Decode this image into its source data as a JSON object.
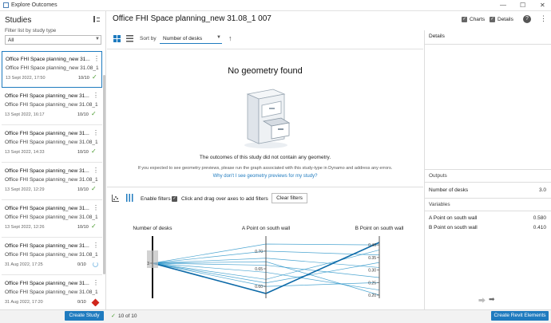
{
  "window": {
    "title": "Explore Outcomes",
    "minimize": "—",
    "maximize": "☐",
    "close": "✕"
  },
  "sidebar": {
    "heading": "Studies",
    "filter_label": "Filter list by study type",
    "filter_value": "All",
    "studies": [
      {
        "name": "Office FHI Space planning_new 31...",
        "subtitle": "Office FHI Space planning_new 31.08_1",
        "date": "13 Sept 2022, 17:50",
        "count": "10/10",
        "status": "complete"
      },
      {
        "name": "Office FHI Space planning_new 31...",
        "subtitle": "Office FHI Space planning_new 31.08_1",
        "date": "13 Sept 2022, 16:17",
        "count": "10/10",
        "status": "complete"
      },
      {
        "name": "Office FHI Space planning_new 31...",
        "subtitle": "Office FHI Space planning_new 31.08_1",
        "date": "13 Sept 2022, 14:33",
        "count": "10/10",
        "status": "complete"
      },
      {
        "name": "Office FHI Space planning_new 31...",
        "subtitle": "Office FHI Space planning_new 31.08_1",
        "date": "13 Sept 2022, 12:29",
        "count": "10/10",
        "status": "complete"
      },
      {
        "name": "Office FHI Space planning_new 31...",
        "subtitle": "Office FHI Space planning_new 31.08_1",
        "date": "13 Sept 2022, 12:26",
        "count": "10/10",
        "status": "complete"
      },
      {
        "name": "Office FHI Space planning_new 31...",
        "subtitle": "Office FHI Space planning_new 31.08_1",
        "date": "31 Aug 2022, 17:25",
        "count": "0/10",
        "status": "running"
      },
      {
        "name": "Office FHI Space planning_new 31...",
        "subtitle": "Office FHI Space planning_new 31.08_1",
        "date": "31 Aug 2022, 17:20",
        "count": "0/10",
        "status": "error"
      }
    ],
    "create_study": "Create Study"
  },
  "status_bar": {
    "text": "10 of 10",
    "create_revit": "Create Revit Elements"
  },
  "main": {
    "title": "Office FHI Space planning_new 31.08_1 007",
    "sort_label": "Sort by",
    "sort_value": "Number of desks",
    "no_geometry_title": "No geometry found",
    "no_geometry_msg": "The outcomes of this study did not contain any geometry.",
    "no_geometry_hint": "If you expected to see geometry previews, please run the graph associated with this study-type in Dynamo and address any errors.",
    "no_geometry_link": "Why don't I see geometry previews for my study?",
    "enable_filters": "Enable filters",
    "filter_hint": "Click and drag over axes to add filters",
    "clear_filters": "Clear filters"
  },
  "topbar": {
    "charts": "Charts",
    "details": "Details",
    "help": "?"
  },
  "details": {
    "heading": "Details",
    "outputs_heading": "Outputs",
    "outputs": [
      {
        "label": "Number of desks",
        "value": "3.0"
      }
    ],
    "variables_heading": "Variables",
    "variables": [
      {
        "label": "A Point on south wall",
        "value": "0.580"
      },
      {
        "label": "B Point on south wall",
        "value": "0.410"
      }
    ]
  },
  "chart_data": {
    "type": "parallel-coordinates",
    "axes": [
      {
        "name": "Number of desks",
        "ticks": [
          "3"
        ]
      },
      {
        "name": "A Point on south wall",
        "ticks": [
          "0.70",
          "0.65",
          "0.60"
        ]
      },
      {
        "name": "B Point on south wall",
        "ticks": [
          "0.40",
          "0.35",
          "0.30",
          "0.25",
          "0.20"
        ]
      }
    ],
    "series_color": "#1f8fc6",
    "lines": [
      [
        3,
        0.72,
        0.4
      ],
      [
        3,
        0.7,
        0.36
      ],
      [
        3,
        0.68,
        0.31
      ],
      [
        3,
        0.66,
        0.27
      ],
      [
        3,
        0.64,
        0.22
      ],
      [
        3,
        0.62,
        0.38
      ],
      [
        3,
        0.6,
        0.25
      ],
      [
        3,
        0.58,
        0.41
      ],
      [
        3,
        0.67,
        0.2
      ],
      [
        3,
        0.61,
        0.33
      ]
    ],
    "highlight": [
      3,
      0.58,
      0.41
    ]
  },
  "colors": {
    "accent": "#1f7bbf",
    "ok": "#4a9b30",
    "error": "#d0261c"
  }
}
